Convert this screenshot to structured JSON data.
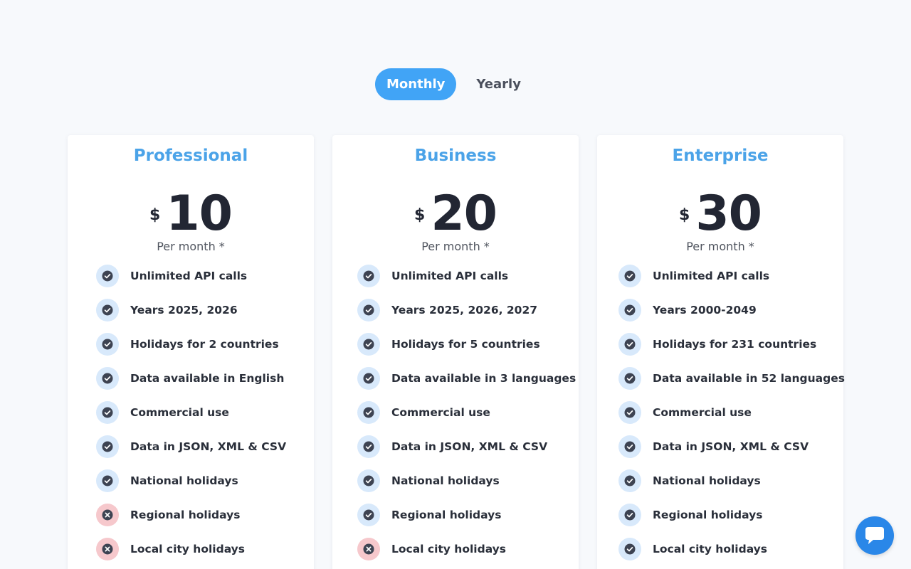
{
  "billing_toggle": {
    "monthly": "Monthly",
    "yearly": "Yearly",
    "selected": "Monthly"
  },
  "colors": {
    "accent": "#41a4f6",
    "title": "#4ba3e8",
    "included_bg": "#d8e9fb",
    "excluded_bg": "#f6c8cc",
    "chat": "#2a87e8"
  },
  "icons": {
    "included": "check-circle-icon",
    "excluded": "x-circle-icon",
    "chat": "chat-bubble-icon"
  },
  "plans": [
    {
      "name": "Professional",
      "currency": "$",
      "price": "10",
      "period": "Per month *",
      "features": [
        {
          "label": "Unlimited API calls",
          "included": true
        },
        {
          "label": "Years 2025, 2026",
          "included": true
        },
        {
          "label": "Holidays for 2 countries",
          "included": true
        },
        {
          "label": "Data available in English",
          "included": true
        },
        {
          "label": "Commercial use",
          "included": true
        },
        {
          "label": "Data in JSON, XML & CSV",
          "included": true
        },
        {
          "label": "National holidays",
          "included": true
        },
        {
          "label": "Regional holidays",
          "included": false
        },
        {
          "label": "Local city holidays",
          "included": false
        }
      ]
    },
    {
      "name": "Business",
      "currency": "$",
      "price": "20",
      "period": "Per month *",
      "features": [
        {
          "label": "Unlimited API calls",
          "included": true
        },
        {
          "label": "Years 2025, 2026, 2027",
          "included": true
        },
        {
          "label": "Holidays for 5 countries",
          "included": true
        },
        {
          "label": "Data available in 3 languages",
          "included": true
        },
        {
          "label": "Commercial use",
          "included": true
        },
        {
          "label": "Data in JSON, XML & CSV",
          "included": true
        },
        {
          "label": "National holidays",
          "included": true
        },
        {
          "label": "Regional holidays",
          "included": true
        },
        {
          "label": "Local city holidays",
          "included": false
        }
      ]
    },
    {
      "name": "Enterprise",
      "currency": "$",
      "price": "30",
      "period": "Per month *",
      "features": [
        {
          "label": "Unlimited API calls",
          "included": true
        },
        {
          "label": "Years 2000-2049",
          "included": true
        },
        {
          "label": "Holidays for 231 countries",
          "included": true
        },
        {
          "label": "Data available in 52 languages",
          "included": true
        },
        {
          "label": "Commercial use",
          "included": true
        },
        {
          "label": "Data in JSON, XML & CSV",
          "included": true
        },
        {
          "label": "National holidays",
          "included": true
        },
        {
          "label": "Regional holidays",
          "included": true
        },
        {
          "label": "Local city holidays",
          "included": true
        }
      ]
    }
  ]
}
